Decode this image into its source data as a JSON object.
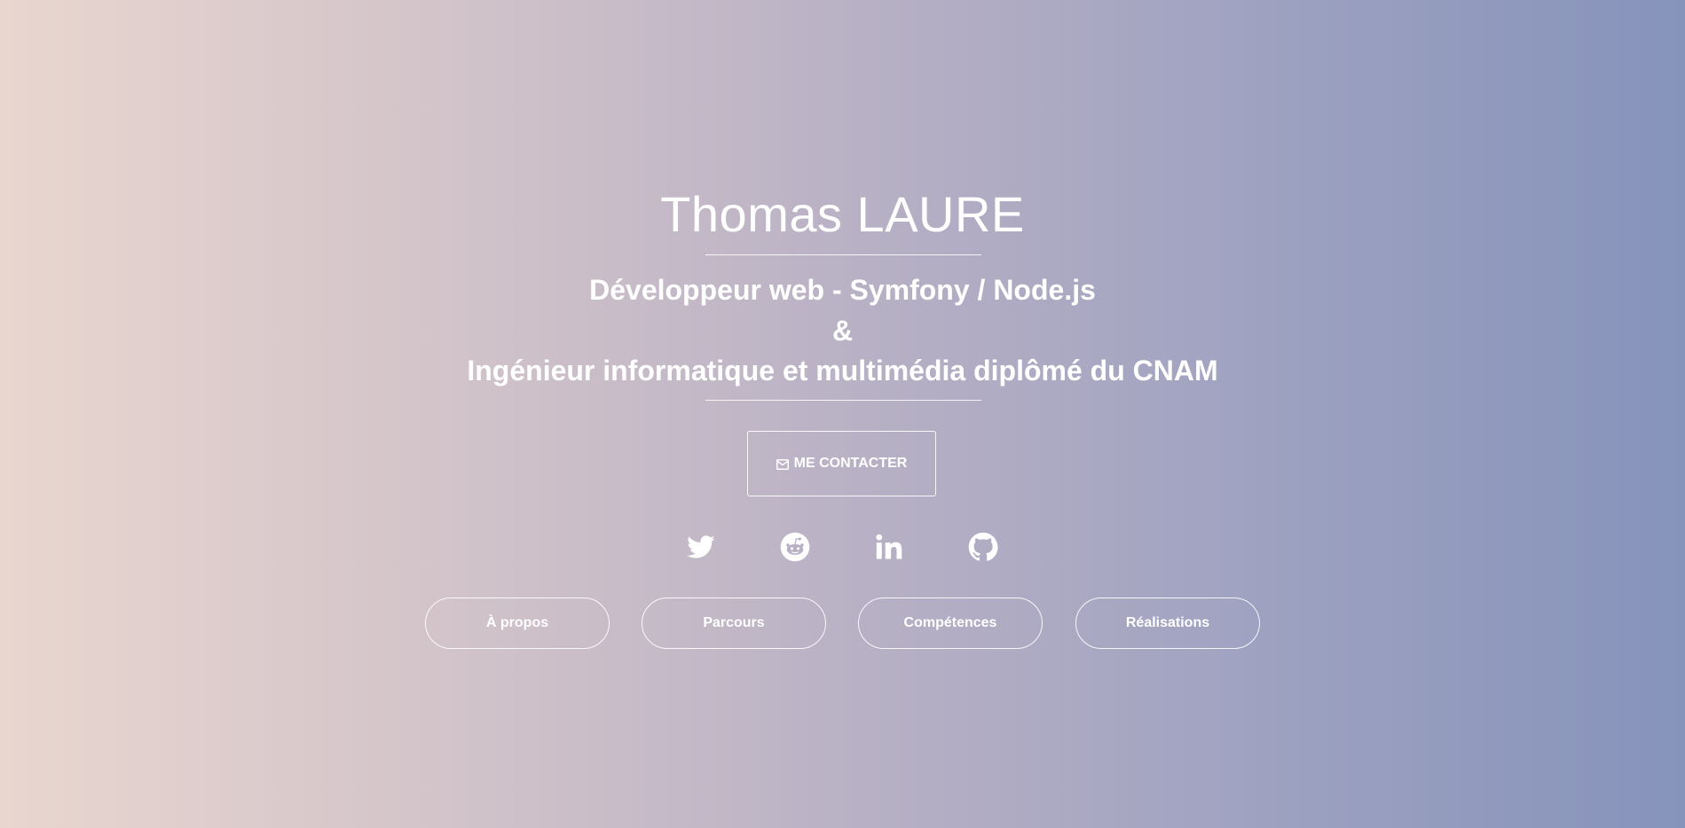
{
  "hero": {
    "name": "Thomas LAURE",
    "subtitle_line1": "Développeur web - Symfony / Node.js",
    "subtitle_line2": "&",
    "subtitle_line3": "Ingénieur informatique et multimédia diplômé du CNAM"
  },
  "contact": {
    "label": "ME CONTACTER",
    "icon": "envelope-icon"
  },
  "socials": [
    {
      "icon": "twitter-icon"
    },
    {
      "icon": "reddit-icon"
    },
    {
      "icon": "linkedin-icon"
    },
    {
      "icon": "github-icon"
    }
  ],
  "nav": [
    {
      "label": "À propos"
    },
    {
      "label": "Parcours"
    },
    {
      "label": "Compétences"
    },
    {
      "label": "Réalisations"
    }
  ],
  "colors": {
    "gradient_left": "#e9d6cf",
    "gradient_right": "#8693bb",
    "text": "#ffffff"
  }
}
